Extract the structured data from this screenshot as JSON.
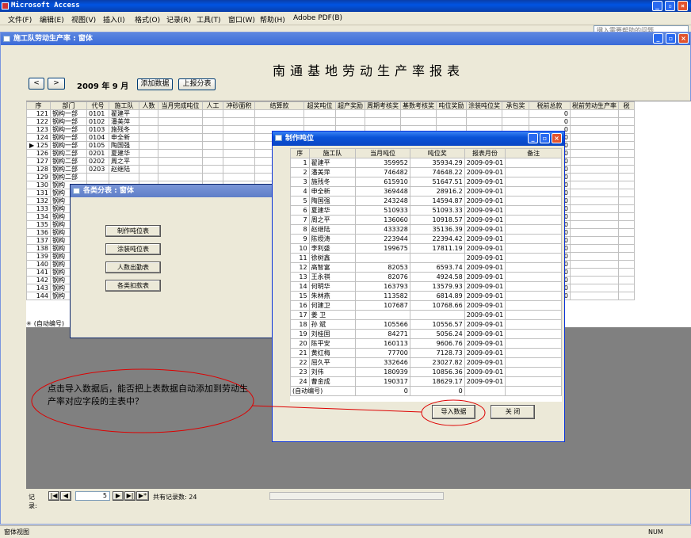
{
  "app": {
    "title": "Microsoft Access",
    "help_placeholder": "键入需要帮助的问题",
    "status": "窗体视图",
    "num": "NUM"
  },
  "menu": [
    "文件(F)",
    "编辑(E)",
    "视图(V)",
    "插入(I)",
    "格式(O)",
    "记录(R)",
    "工具(T)",
    "窗口(W)",
    "帮助(H)",
    "Adobe PDF(B)"
  ],
  "main_window": {
    "title": "施工队劳动生产率 : 窗体",
    "report_title": "南通基地劳动生产率报表",
    "year_month": "2009 年  9 月",
    "btn_add": "添加数据",
    "btn_report": "上报分表",
    "prev": "<",
    "next": ">"
  },
  "main_grid": {
    "headers": [
      "序",
      "部门",
      "代号",
      "施工队",
      "人数",
      "当月完成吨位",
      "人工",
      "冲砂面积",
      "结算款",
      "超奖吨位",
      "超产奖励",
      "周期考核奖",
      "基数考核奖",
      "吨位奖励",
      "涂装吨位奖",
      "承包奖",
      "税前总款",
      "税前劳动生产率",
      "税"
    ],
    "rows": [
      [
        "121",
        "钢构一部",
        "0101",
        "翟建平",
        "0"
      ],
      [
        "122",
        "钢构一部",
        "0102",
        "潘美萍",
        "0"
      ],
      [
        "123",
        "钢构一部",
        "0103",
        "施残冬",
        "0"
      ],
      [
        "124",
        "钢构一部",
        "0104",
        "申全新",
        "0"
      ],
      [
        "125",
        "钢构一部",
        "0105",
        "陶国强",
        "0"
      ],
      [
        "126",
        "钢构二部",
        "0201",
        "夏建华",
        "0"
      ],
      [
        "127",
        "钢构二部",
        "0202",
        "周之平",
        "0"
      ],
      [
        "128",
        "钢构二部",
        "0203",
        "赵继陆",
        "0"
      ],
      [
        "129",
        "钢构二部",
        "",
        "",
        "0"
      ],
      [
        "130",
        "钢构",
        "",
        "",
        "0"
      ],
      [
        "131",
        "钢构",
        "",
        "",
        "0"
      ],
      [
        "132",
        "钢构",
        "",
        "",
        "0"
      ],
      [
        "133",
        "钢构",
        "",
        "",
        "0"
      ],
      [
        "134",
        "钢构",
        "",
        "",
        "0"
      ],
      [
        "135",
        "钢构",
        "",
        "",
        "0"
      ],
      [
        "136",
        "钢构",
        "",
        "",
        "0"
      ],
      [
        "137",
        "钢构",
        "",
        "",
        "0"
      ],
      [
        "138",
        "钢构",
        "",
        "",
        "0"
      ],
      [
        "139",
        "钢构",
        "",
        "",
        "0"
      ],
      [
        "140",
        "钢构",
        "",
        "",
        "0"
      ],
      [
        "141",
        "钢构",
        "",
        "",
        "0"
      ],
      [
        "142",
        "钢构",
        "",
        "",
        "0"
      ],
      [
        "143",
        "钢构",
        "",
        "",
        "0"
      ],
      [
        "144",
        "钢构",
        "",
        "",
        "0"
      ]
    ],
    "new_row_label": "(自动编号)",
    "new_row_mark": "✳",
    "current_mark": "▶"
  },
  "record_nav": {
    "label": "记录:",
    "current": "5",
    "total_label": "共有记录数: 24"
  },
  "category_window": {
    "title": "各类分表 : 窗体",
    "buttons": [
      "制作吨位表",
      "涂装吨位表",
      "人数出勤表",
      "各类扣款表"
    ]
  },
  "tonnage_window": {
    "title": "制作吨位",
    "headers": [
      "序",
      "施工队",
      "当月吨位",
      "吨位奖",
      "报表月份",
      "备注"
    ],
    "rows": [
      [
        "1",
        "翟建平",
        "359952",
        "35934.29",
        "2009-09-01"
      ],
      [
        "2",
        "潘美萍",
        "746482",
        "74648.22",
        "2009-09-01"
      ],
      [
        "3",
        "施残冬",
        "615910",
        "51647.51",
        "2009-09-01"
      ],
      [
        "4",
        "申全新",
        "369448",
        "28916.2",
        "2009-09-01"
      ],
      [
        "5",
        "陶国强",
        "243248",
        "14594.87",
        "2009-09-01"
      ],
      [
        "6",
        "夏建华",
        "510933",
        "51093.33",
        "2009-09-01"
      ],
      [
        "7",
        "周之平",
        "136060",
        "10918.57",
        "2009-09-01"
      ],
      [
        "8",
        "赵继陆",
        "433328",
        "35136.39",
        "2009-09-01"
      ],
      [
        "9",
        "陈绶涛",
        "223944",
        "22394.42",
        "2009-09-01"
      ],
      [
        "10",
        "李利盛",
        "199675",
        "17811.19",
        "2009-09-01"
      ],
      [
        "11",
        "徐树鑫",
        "",
        "",
        "2009-09-01"
      ],
      [
        "12",
        "高智富",
        "82053",
        "6593.74",
        "2009-09-01"
      ],
      [
        "13",
        "王永祺",
        "82076",
        "4924.58",
        "2009-09-01"
      ],
      [
        "14",
        "何明华",
        "163793",
        "13579.93",
        "2009-09-01"
      ],
      [
        "15",
        "朱林燕",
        "113582",
        "6814.89",
        "2009-09-01"
      ],
      [
        "16",
        "何建卫",
        "107687",
        "10768.66",
        "2009-09-01"
      ],
      [
        "17",
        "姜  卫",
        "",
        "",
        "2009-09-01"
      ],
      [
        "18",
        "孙  斌",
        "105566",
        "10556.57",
        "2009-09-01"
      ],
      [
        "19",
        "刘桂固",
        "84271",
        "5056.24",
        "2009-09-01"
      ],
      [
        "20",
        "陈平安",
        "160113",
        "9606.76",
        "2009-09-01"
      ],
      [
        "21",
        "黄红梅",
        "77700",
        "7128.73",
        "2009-09-01"
      ],
      [
        "22",
        "屈久平",
        "332646",
        "23027.82",
        "2009-09-01"
      ],
      [
        "23",
        "刘伟",
        "180939",
        "10856.36",
        "2009-09-01"
      ],
      [
        "24",
        "曹金成",
        "190317",
        "18629.17",
        "2009-09-01"
      ]
    ],
    "new_row": [
      "(自动编号)",
      "",
      "0",
      "0",
      ""
    ],
    "btn_import": "导入数据",
    "btn_close": "关  闭"
  },
  "annotation": "点击导入数据后，能否把上表数据自动添加到劳动生产率对应字段的主表中？"
}
